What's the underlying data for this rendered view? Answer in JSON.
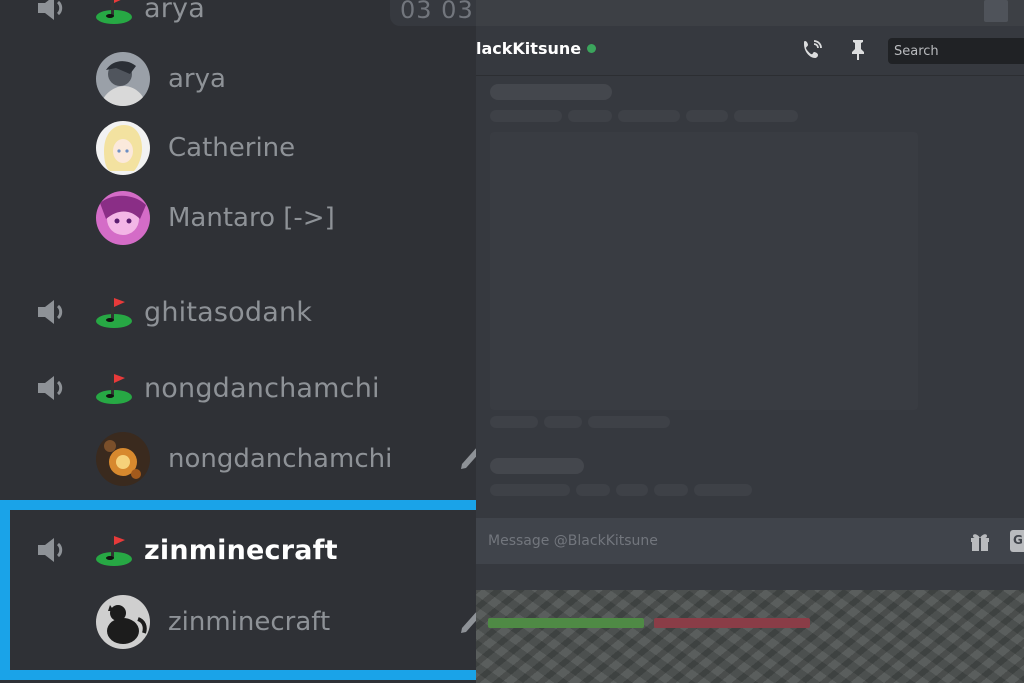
{
  "sidebar": {
    "timer": "03 03",
    "channels": [
      {
        "name": "arya",
        "users": [
          {
            "name": "arya"
          },
          {
            "name": "Catherine"
          },
          {
            "name": "Mantaro [->]"
          }
        ]
      },
      {
        "name": "ghitasodank",
        "users": []
      },
      {
        "name": "nongdanchamchi",
        "users": [
          {
            "name": "nongdanchamchi"
          }
        ]
      },
      {
        "name": "zinminecraft",
        "users": [
          {
            "name": "zinminecraft"
          }
        ]
      }
    ]
  },
  "dm": {
    "title": "lackKitsune",
    "search_placeholder": "Search",
    "message_placeholder": "Message @BlackKitsune",
    "gif_label": "G"
  },
  "colors": {
    "accent_highlight": "#1aa3e8",
    "online": "#3ba55c"
  },
  "icons": [
    "speaker-icon",
    "golf-flag-icon",
    "call-icon",
    "pin-icon",
    "gift-icon",
    "mic-icon"
  ]
}
